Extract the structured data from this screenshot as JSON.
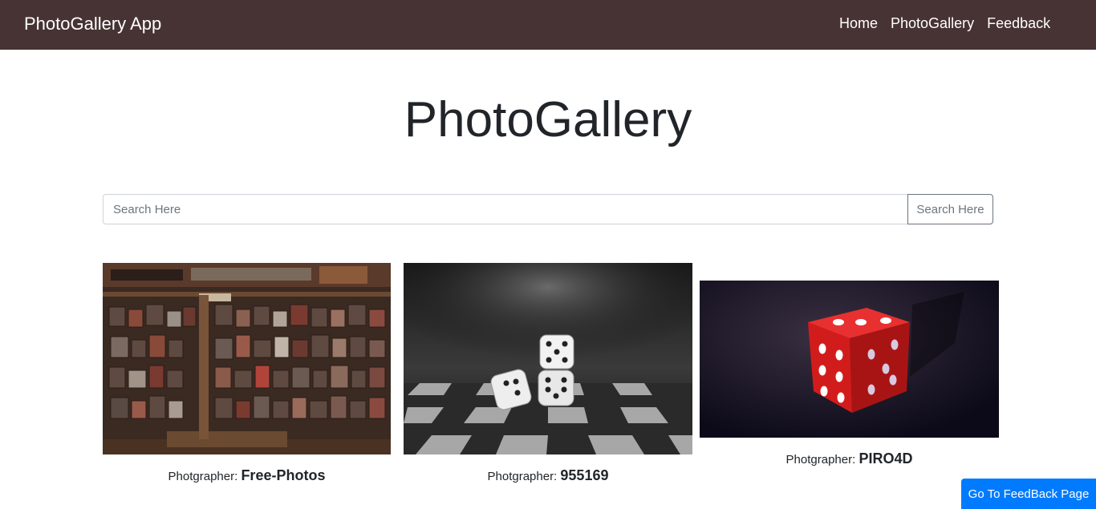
{
  "navbar": {
    "brand": "PhotoGallery App",
    "links": [
      "Home",
      "PhotoGallery",
      "Feedback"
    ]
  },
  "page": {
    "title": "PhotoGallery"
  },
  "search": {
    "placeholder": "Search Here",
    "button_label": "Search Here"
  },
  "photos": [
    {
      "label": "Photgrapher: ",
      "name": "Free-Photos",
      "icon": "letterpress-type-image"
    },
    {
      "label": "Photgrapher: ",
      "name": "955169",
      "icon": "dice-on-chessboard-image"
    },
    {
      "label": "Photgrapher: ",
      "name": "PIRO4D",
      "icon": "red-die-image"
    }
  ],
  "footer": {
    "feedback_button": "Go To FeedBack Page"
  },
  "colors": {
    "navbar": "#473334",
    "primary": "#007bff",
    "secondary": "#6c757d"
  }
}
